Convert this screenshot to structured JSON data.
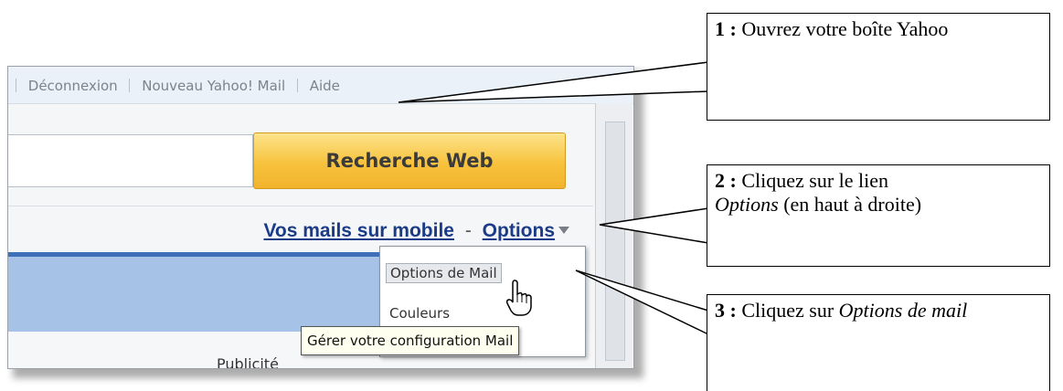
{
  "screenshot": {
    "top_links": [
      "Déconnexion",
      "Nouveau Yahoo! Mail",
      "Aide"
    ],
    "search_button": "Recherche Web",
    "mobile_link": "Vos mails sur mobile",
    "separator": "-",
    "options_link": "Options",
    "dropdown": {
      "items": [
        "Options de Mail",
        "Couleurs"
      ],
      "highlighted": "Options de Mail"
    },
    "tooltip": "Gérer votre configuration Mail",
    "partial_text": "Publicité"
  },
  "callouts": [
    {
      "num": "1 :",
      "text": "Ouvrez votre boîte Yahoo"
    },
    {
      "num": "2 :",
      "text_pre": "Cliquez sur le lien",
      "text_em": "Options",
      "text_post": "(en haut à droite)"
    },
    {
      "num": "3 :",
      "text_pre": "Cliquez sur",
      "text_em": "Options de mail"
    }
  ],
  "colors": {
    "button_gradient_top": "#fde48b",
    "button_gradient_bottom": "#f2b32c",
    "link_blue": "#1a3b86",
    "panel_blue": "#a7c2e7",
    "tooltip_bg": "#fffff0"
  }
}
